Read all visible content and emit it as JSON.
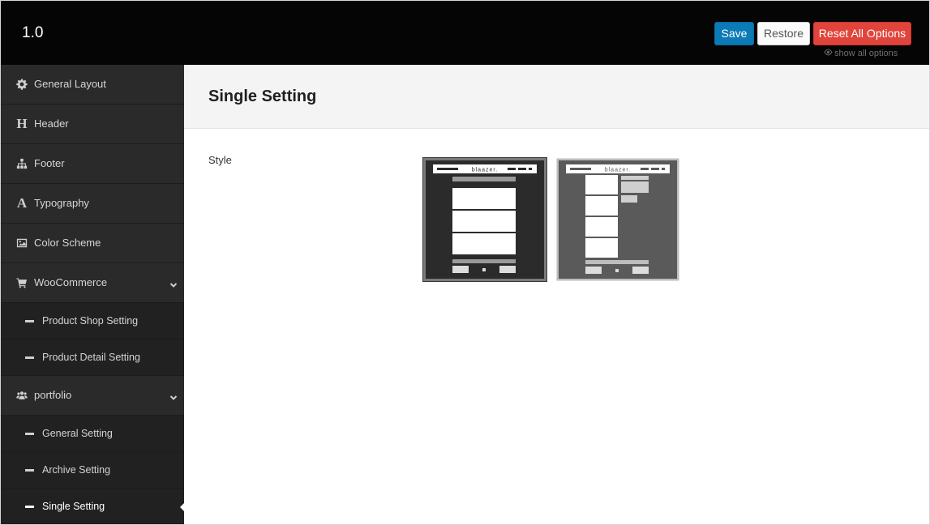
{
  "header": {
    "version": "1.0",
    "buttons": {
      "save": "Save",
      "restore": "Restore",
      "reset": "Reset All Options"
    },
    "show_all_options": "show all options"
  },
  "sidebar": {
    "items": [
      {
        "label": "General Layout",
        "icon": "gear-icon"
      },
      {
        "label": "Header",
        "icon": "heading-icon"
      },
      {
        "label": "Footer",
        "icon": "sitemap-icon"
      },
      {
        "label": "Typography",
        "icon": "font-icon"
      },
      {
        "label": "Color Scheme",
        "icon": "image-icon"
      },
      {
        "label": "WooCommerce",
        "icon": "cart-icon",
        "expanded": true,
        "children": [
          {
            "label": "Product Shop Setting"
          },
          {
            "label": "Product Detail Setting"
          }
        ]
      },
      {
        "label": "portfolio",
        "icon": "users-icon",
        "expanded": true,
        "children": [
          {
            "label": "General Setting"
          },
          {
            "label": "Archive Setting"
          },
          {
            "label": "Single Setting",
            "active": true
          }
        ]
      }
    ]
  },
  "main": {
    "title": "Single Setting",
    "fields": [
      {
        "label": "Style",
        "options": [
          {
            "name": "layout-1",
            "brand": "blaazer.",
            "selected": true
          },
          {
            "name": "layout-2",
            "brand": "blaazer.",
            "selected": false
          }
        ]
      }
    ]
  },
  "colors": {
    "topbar": "#050505",
    "sidebar": "#2a2a2a",
    "submenu": "#212121",
    "save": "#0b7ab6",
    "reset": "#e0443b"
  }
}
